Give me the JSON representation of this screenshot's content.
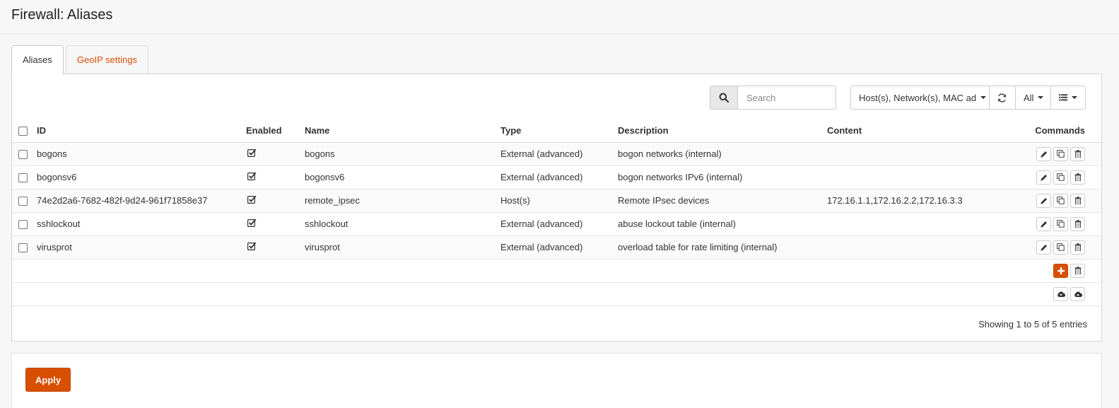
{
  "page": {
    "title": "Firewall: Aliases"
  },
  "tabs": [
    {
      "label": "Aliases",
      "active": true
    },
    {
      "label": "GeoIP settings",
      "active": false
    }
  ],
  "toolbar": {
    "search_placeholder": "Search",
    "type_filter": "Host(s), Network(s), MAC ad",
    "row_count": "All"
  },
  "table": {
    "columns": [
      "ID",
      "Enabled",
      "Name",
      "Type",
      "Description",
      "Content",
      "Commands"
    ],
    "rows": [
      {
        "id": "bogons",
        "enabled": true,
        "name": "bogons",
        "type": "External (advanced)",
        "description": "bogon networks (internal)",
        "content": ""
      },
      {
        "id": "bogonsv6",
        "enabled": true,
        "name": "bogonsv6",
        "type": "External (advanced)",
        "description": "bogon networks IPv6 (internal)",
        "content": ""
      },
      {
        "id": "74e2d2a6-7682-482f-9d24-961f71858e37",
        "enabled": true,
        "name": "remote_ipsec",
        "type": "Host(s)",
        "description": "Remote IPsec devices",
        "content": "172.16.1.1,172.16.2.2,172.16.3.3"
      },
      {
        "id": "sshlockout",
        "enabled": true,
        "name": "sshlockout",
        "type": "External (advanced)",
        "description": "abuse lockout table (internal)",
        "content": ""
      },
      {
        "id": "virusprot",
        "enabled": true,
        "name": "virusprot",
        "type": "External (advanced)",
        "description": "overload table for rate limiting (internal)",
        "content": ""
      }
    ]
  },
  "footer": {
    "info": "Showing 1 to 5 of 5 entries"
  },
  "apply": {
    "label": "Apply"
  },
  "colors": {
    "accent": "#d94f00"
  },
  "icons": {
    "search": "search-icon",
    "refresh": "refresh-icon",
    "columns": "list-icon",
    "enabled": "checked-box-icon",
    "edit": "pencil-icon",
    "copy": "copy-icon",
    "delete": "trash-icon",
    "add": "plus-icon",
    "import": "cloud-upload-icon",
    "export": "cloud-download-icon"
  }
}
